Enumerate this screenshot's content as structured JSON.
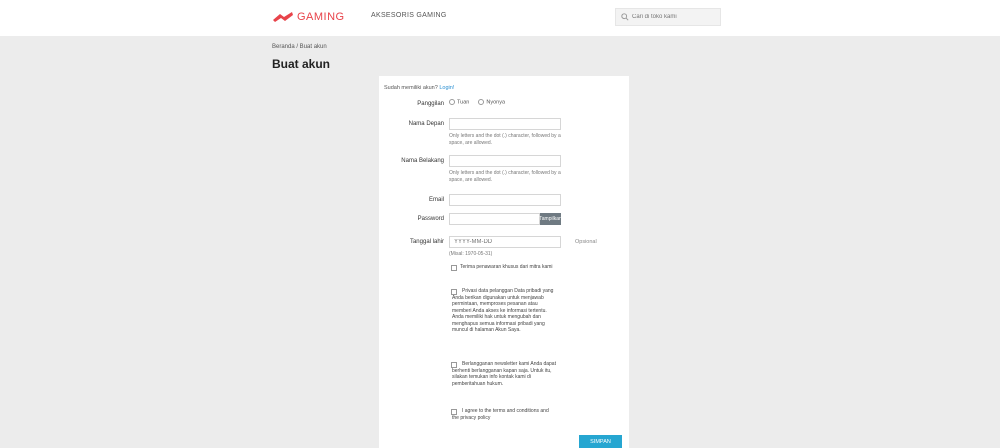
{
  "header": {
    "logo_text": "GAMING",
    "nav_link": "AKSESORIS GAMING",
    "search_placeholder": "Cari di toko kami"
  },
  "page": {
    "breadcrumb": "Beranda / Buat akun",
    "title": "Buat akun"
  },
  "form": {
    "login_prompt": "Sudah memiliki akun?",
    "login_link": "Login!",
    "title_label": "Panggilan",
    "title_options": [
      "Tuan",
      "Nyonya"
    ],
    "first_name_label": "Nama Depan",
    "first_name_help": "Only letters and the dot (.) character, followed by a space, are allowed.",
    "last_name_label": "Nama Belakang",
    "last_name_help": "Only letters and the dot (.) character, followed by a space, are allowed.",
    "email_label": "Email",
    "password_label": "Password",
    "show_button": "Tampilkan",
    "birthdate_label": "Tanggal lahir",
    "birthdate_placeholder": "YYYY-MM-DD",
    "birthdate_optional": "Opsional",
    "birthdate_example": "(Misal: 1970-05-31)",
    "checkbox_offers": "Terima penawaran khusus dari mitra kami",
    "checkbox_newsletter": "Privasi data pelanggan Data pribadi yang Anda berikan digunakan untuk menjawab permintaan, memproses pesanan atau memberi Anda akses ke informasi tertentu. Anda memiliki hak untuk mengubah dan menghapus semua informasi pribadi yang muncul di halaman Akun Saya.",
    "checkbox_privacy": "Berlangganan newsletter kami Anda dapat berhenti berlangganan kapan saja. Untuk itu, silakan temukan info kontak kami di pemberitahuan hukum.",
    "checkbox_terms": "I agree to the terms and conditions and the privacy policy",
    "submit_label": "SIMPAN"
  },
  "colors": {
    "brand": "#e8434a",
    "accent": "#26a6d1",
    "background": "#ececec"
  }
}
